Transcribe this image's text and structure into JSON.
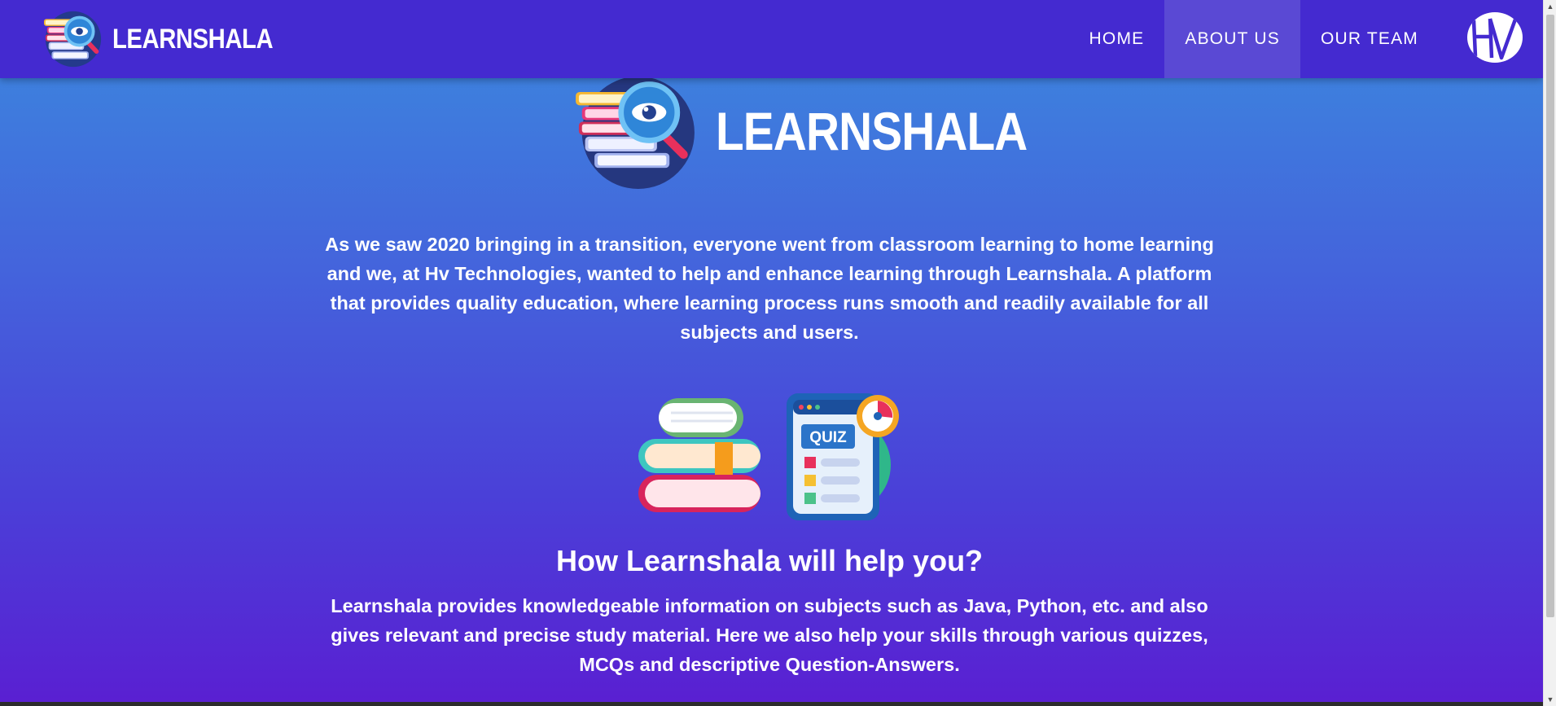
{
  "header": {
    "brand": "LEARNSHALA",
    "logo_icon": "books-magnifier-icon",
    "nav": [
      {
        "label": "HOME",
        "active": false
      },
      {
        "label": "ABOUT US",
        "active": true
      },
      {
        "label": "OUR TEAM",
        "active": false
      }
    ],
    "partner_logo": "hv-technologies-logo"
  },
  "hero": {
    "brand": "LEARNSHALA",
    "logo_icon": "books-magnifier-icon"
  },
  "about": {
    "intro": "As we saw 2020 bringing in a transition, everyone went from classroom learning to home learning and we, at Hv Technologies, wanted to help and enhance learning through Learnshala. A platform that provides quality education, where learning process runs smooth and readily available for all subjects and users.",
    "illustrations": [
      "books-stack-icon",
      "quiz-icon"
    ],
    "quiz_label": "QUIZ",
    "help_title": "How Learnshala will help you?",
    "help_text": "Learnshala provides knowledgeable information on subjects such as Java, Python, etc. and also gives relevant and precise study material. Here we also help your skills through various quizzes, MCQs and descriptive Question-Answers."
  },
  "colors": {
    "navbar": "#442ad0",
    "active_tab": "#5a49d4",
    "gradient_top": "#3b8ade",
    "gradient_bottom": "#5a1fd2",
    "text": "#ffffff"
  }
}
